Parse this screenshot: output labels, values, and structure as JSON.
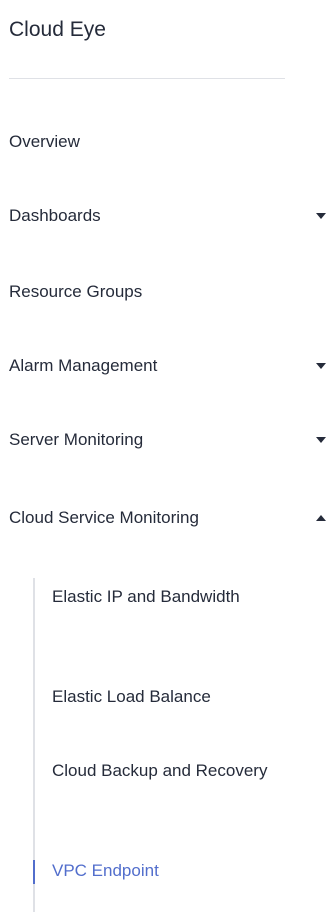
{
  "nav": {
    "title": "Cloud Eye",
    "items": [
      {
        "label": "Overview",
        "arrow": "none"
      },
      {
        "label": "Dashboards",
        "arrow": "down"
      },
      {
        "label": "Resource Groups",
        "arrow": "none"
      },
      {
        "label": "Alarm Management",
        "arrow": "down"
      },
      {
        "label": "Server Monitoring",
        "arrow": "down"
      },
      {
        "label": "Cloud Service Monitoring",
        "arrow": "up"
      }
    ],
    "subitems": [
      {
        "label": "Elastic IP and Bandwidth",
        "active": false
      },
      {
        "label": "Elastic Load Balance",
        "active": false
      },
      {
        "label": "Cloud Backup and Recovery",
        "active": false
      },
      {
        "label": "VPC Endpoint",
        "active": true
      }
    ],
    "colors": {
      "text": "#252b3a",
      "active": "#526ecc",
      "divider": "#dfe1e6"
    },
    "icons": {
      "collapsed": "chevron-down-icon",
      "expanded": "chevron-up-icon"
    }
  }
}
